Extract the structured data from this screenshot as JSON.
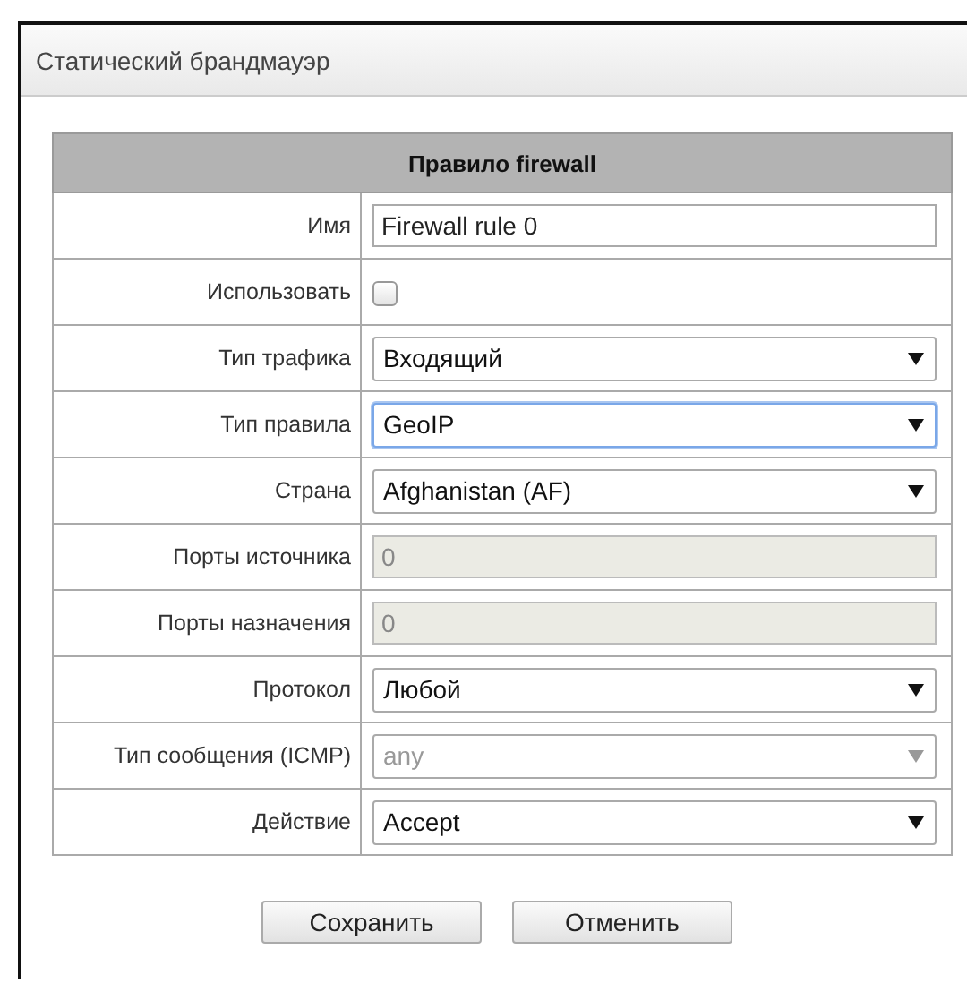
{
  "window": {
    "title": "Статический брандмауэр"
  },
  "form": {
    "title": "Правило firewall",
    "rows": [
      {
        "kind": "text",
        "label": "Имя",
        "value": "Firewall rule 0",
        "disabled": false
      },
      {
        "kind": "checkbox",
        "label": "Использовать",
        "checked": false
      },
      {
        "kind": "select",
        "label": "Тип трафика",
        "value": "Входящий",
        "disabled": false,
        "focused": false
      },
      {
        "kind": "select",
        "label": "Тип правила",
        "value": "GeoIP",
        "disabled": false,
        "focused": true
      },
      {
        "kind": "select",
        "label": "Страна",
        "value": "Afghanistan (AF)",
        "disabled": false,
        "focused": false
      },
      {
        "kind": "text",
        "label": "Порты источника",
        "value": "0",
        "disabled": true
      },
      {
        "kind": "text",
        "label": "Порты назначения",
        "value": "0",
        "disabled": true
      },
      {
        "kind": "select",
        "label": "Протокол",
        "value": "Любой",
        "disabled": false,
        "focused": false
      },
      {
        "kind": "select",
        "label": "Тип сообщения (ICMP)",
        "value": "any",
        "disabled": true,
        "focused": false
      },
      {
        "kind": "select",
        "label": "Действие",
        "value": "Accept",
        "disabled": false,
        "focused": false
      }
    ]
  },
  "buttons": [
    {
      "label": "Сохранить"
    },
    {
      "label": "Отменить"
    }
  ]
}
